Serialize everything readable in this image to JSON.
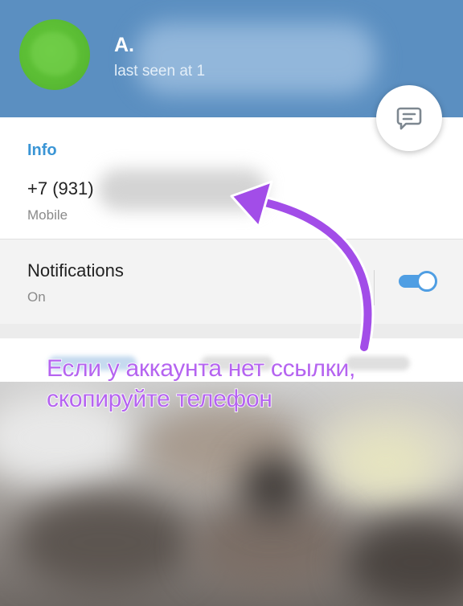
{
  "header": {
    "name": "A.",
    "last_seen": "last seen at 1",
    "accent_color": "#5b8fc1"
  },
  "message_button": {
    "icon": "message-icon"
  },
  "info": {
    "heading": "Info",
    "phone": "+7 (931)",
    "phone_label": "Mobile"
  },
  "notifications": {
    "title": "Notifications",
    "status": "On",
    "enabled": true,
    "toggle_color": "#4f9ee3"
  },
  "annotation": {
    "line1": "Если у аккаунта нет ссылки,",
    "line2": "скопируйте телефон",
    "color": "#b564f0"
  }
}
